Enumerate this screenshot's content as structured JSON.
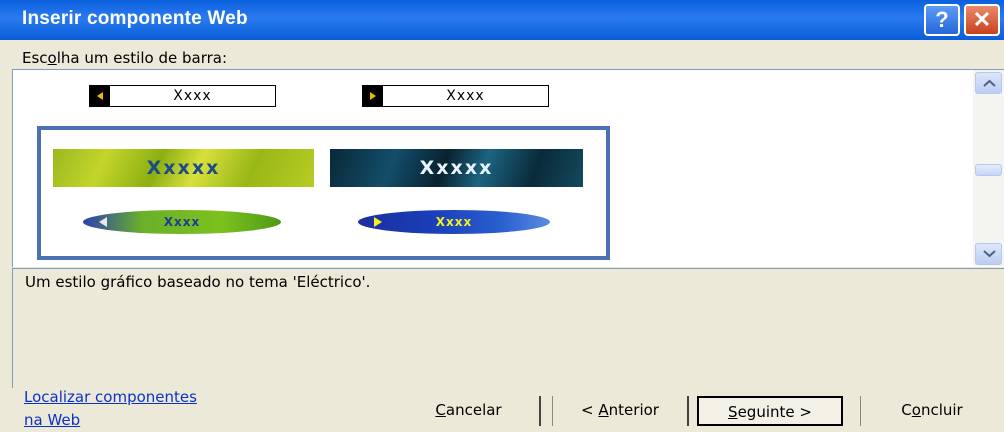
{
  "window": {
    "title": "Inserir componente Web",
    "help_label": "?",
    "close_label": "✕"
  },
  "prompt": {
    "label_pre": "Esc",
    "label_accel": "o",
    "label_post": "lha um estilo de barra:"
  },
  "styles": {
    "simple_left": {
      "text": "Xxxx"
    },
    "simple_right": {
      "text": "Xxxx"
    },
    "electric_yellow": {
      "text": "Xxxxx"
    },
    "electric_dark": {
      "text": "Xxxxx"
    },
    "oval_green": {
      "text": "Xxxx"
    },
    "oval_blue": {
      "text": "Xxxx"
    }
  },
  "description": "Um estilo gráfico baseado no tema 'Eléctrico'.",
  "link": {
    "line1": "Localizar componentes",
    "line2": "na Web"
  },
  "buttons": {
    "cancel": {
      "accel": "C",
      "rest": "ancelar"
    },
    "back": {
      "pre": "< ",
      "accel": "A",
      "rest": "nterior"
    },
    "next": {
      "accel": "S",
      "rest": "eguinte >"
    },
    "finish": {
      "pre": "C",
      "accel": "o",
      "rest": "ncluir"
    }
  },
  "colors": {
    "title_bar": "#0A5FDC",
    "selection_border": "#4B70B3",
    "link": "#0B32C8"
  },
  "icons": {
    "help": "question-icon",
    "close": "close-icon",
    "scroll_up": "chevron-up-icon",
    "scroll_down": "chevron-down-icon"
  }
}
